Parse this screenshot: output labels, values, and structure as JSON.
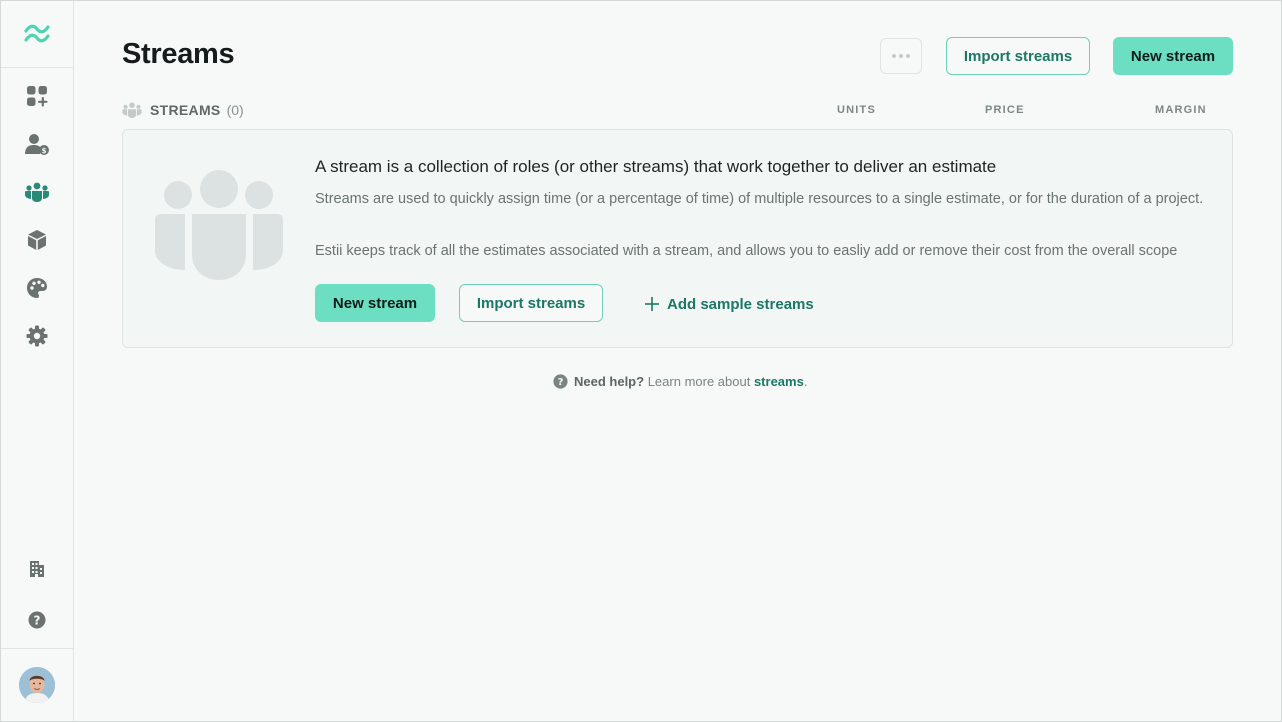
{
  "colors": {
    "accent": "#6cdfc3",
    "accent_text": "#1c7766",
    "icon": "#6b7371",
    "background": "#f6f9f8"
  },
  "sidebar": {
    "logo_icon": "wave-logo-icon",
    "items": [
      {
        "name": "dashboard-add-icon",
        "active": false
      },
      {
        "name": "roles-pricing-icon",
        "active": false
      },
      {
        "name": "streams-icon",
        "active": true
      },
      {
        "name": "products-box-icon",
        "active": false
      },
      {
        "name": "palette-icon",
        "active": false
      },
      {
        "name": "settings-gear-icon",
        "active": false
      }
    ],
    "bottom_items": [
      {
        "name": "company-building-icon"
      },
      {
        "name": "help-icon"
      }
    ],
    "avatar": "user-avatar"
  },
  "header": {
    "title": "Streams",
    "more_icon": "ellipsis-icon",
    "import_label": "Import streams",
    "new_label": "New stream"
  },
  "table": {
    "section_title": "STREAMS",
    "count": "(0)",
    "columns": [
      "UNITS",
      "PRICE",
      "MARGIN"
    ]
  },
  "empty_state": {
    "heading": "A stream is a collection of roles (or other streams) that work together to deliver an estimate",
    "paragraph1": "Streams are used to quickly assign time (or a percentage of time) of multiple resources to a single estimate, or for the duration of a project.",
    "paragraph2": "Estii keeps track of all the estimates associated with a stream, and allows you to easliy add or remove their cost from the overall scope",
    "new_label": "New stream",
    "import_label": "Import streams",
    "sample_label": "Add sample streams"
  },
  "help": {
    "prefix": "Need help?",
    "middle": "Learn more about",
    "link": "streams",
    "suffix": "."
  }
}
